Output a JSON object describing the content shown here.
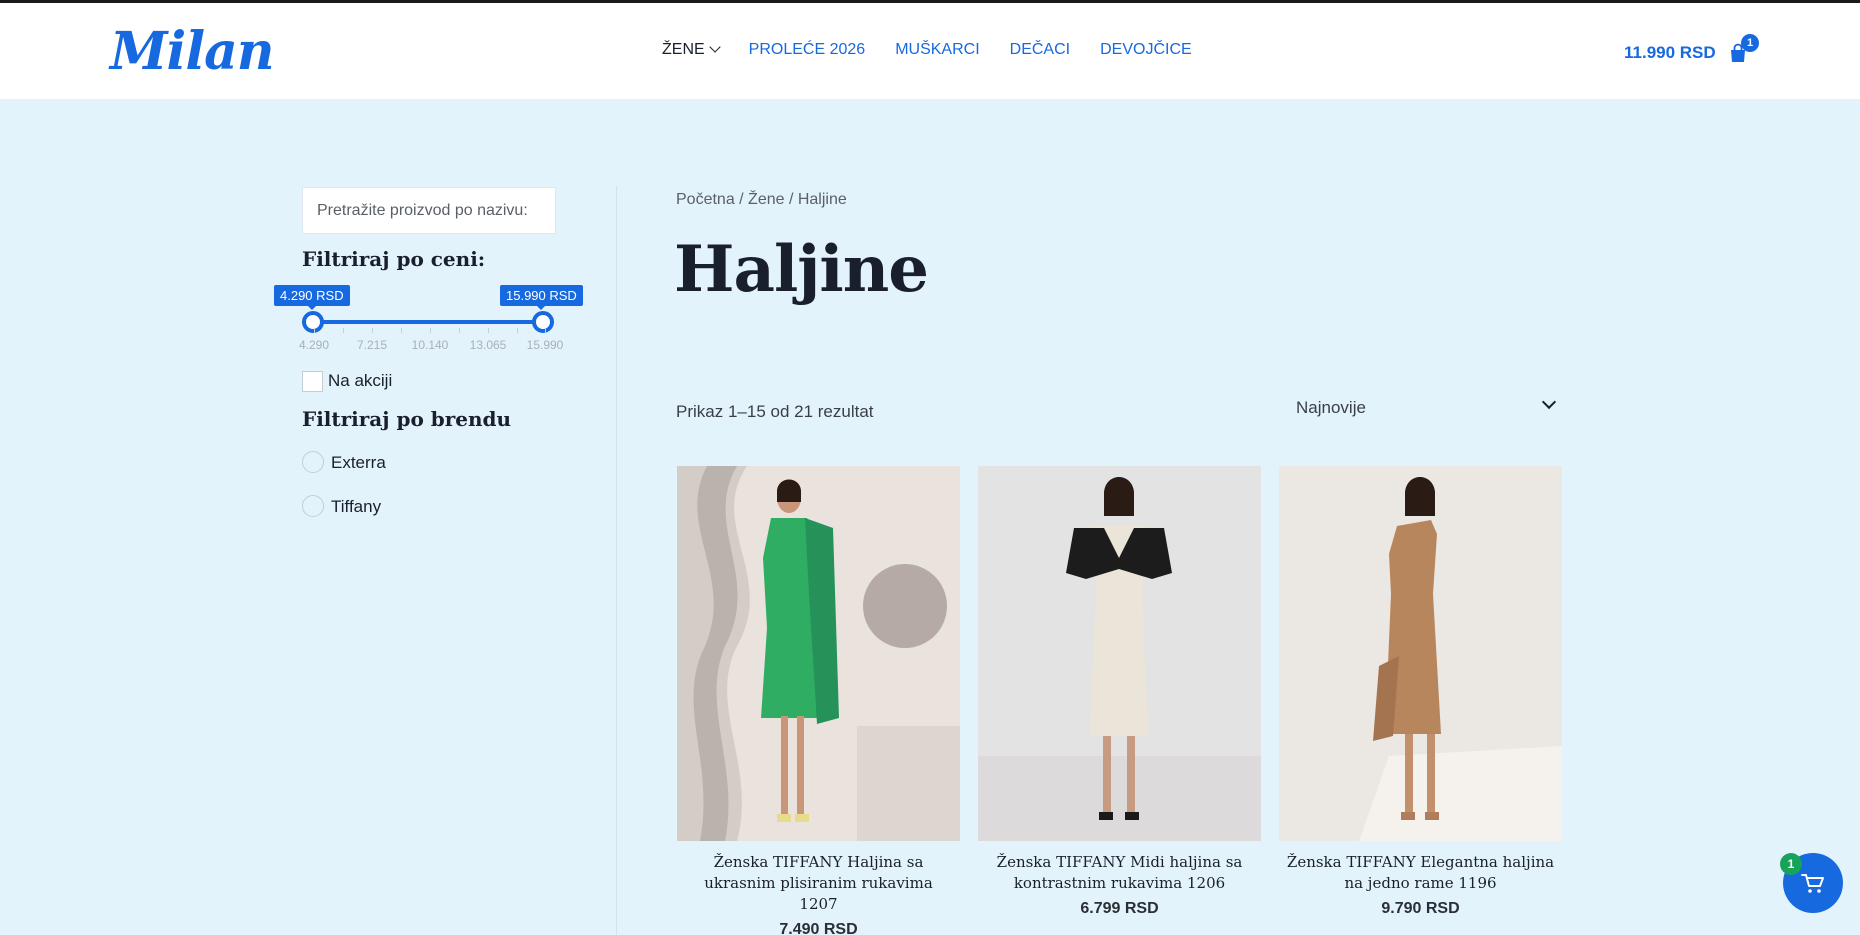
{
  "header": {
    "logo": "Milan",
    "nav": [
      {
        "label": "ŽENE",
        "active": true,
        "has_dropdown": true
      },
      {
        "label": "PROLEĆE 2026"
      },
      {
        "label": "MUŠKARCI"
      },
      {
        "label": "DEČACI"
      },
      {
        "label": "DEVOJČICE"
      }
    ],
    "cart_total": "11.990 RSD",
    "cart_count": "1"
  },
  "sidebar": {
    "search_placeholder": "Pretražite proizvod po nazivu:",
    "price_filter_title": "Filtriraj po ceni:",
    "price_min_label": "4.290 RSD",
    "price_max_label": "15.990 RSD",
    "price_range": {
      "min": 4290,
      "max": 15990,
      "selected_min": 4290,
      "selected_max": 15990
    },
    "scale_labels": [
      "4.290",
      "7.215",
      "10.140",
      "13.065",
      "15.990"
    ],
    "on_sale_label": "Na akciji",
    "brand_filter_title": "Filtriraj po brendu",
    "brands": [
      "Exterra",
      "Tiffany"
    ]
  },
  "main": {
    "breadcrumb": "Početna / Žene / Haljine",
    "title": "Haljine",
    "result_count": "Prikaz 1–15 od 21 rezultat",
    "sort_value": "Najnovije",
    "products": [
      {
        "name": "Ženska TIFFANY Haljina sa ukrasnim plisiranim rukavima 1207",
        "price": "7.490 RSD",
        "dress_color": "#2fae63"
      },
      {
        "name": "Ženska TIFFANY Midi haljina sa kontrastnim rukavima 1206",
        "price": "6.799 RSD",
        "dress_color": "#ebe4d8"
      },
      {
        "name": "Ženska TIFFANY Elegantna haljina na jedno rame 1196",
        "price": "9.790 RSD",
        "dress_color": "#b8865c"
      }
    ]
  },
  "floating_cart": {
    "count": "1"
  },
  "colors": {
    "accent": "#1769e0",
    "background": "#e3f3fc",
    "badge_green": "#18a35b"
  }
}
